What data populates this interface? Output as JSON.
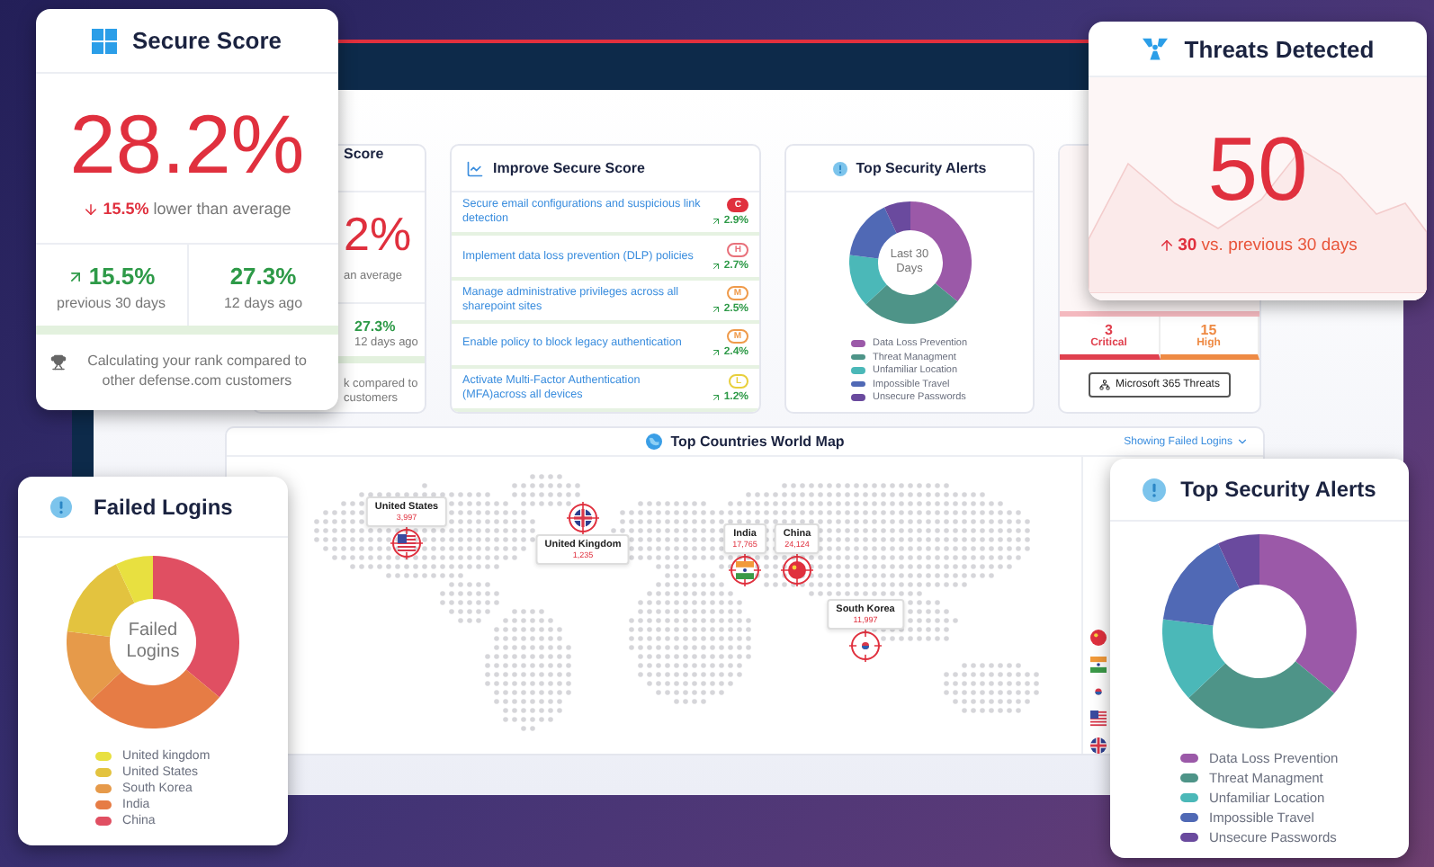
{
  "dashboard": {
    "secure_score_card": {
      "title": "Score",
      "value": "2%",
      "comparison": "an average",
      "stat_value": "27.3%",
      "stat_label": "12 days ago",
      "footer_lines": [
        "k compared to",
        "customers"
      ]
    },
    "improve_card": {
      "title": "Improve Secure Score",
      "items": [
        {
          "text": "Secure email configurations and suspicious link detection",
          "badge": "C",
          "color": "#e0303e",
          "change": "2.9%"
        },
        {
          "text": "Implement data loss prevention (DLP) policies",
          "badge": "H",
          "color": "#e8707a",
          "change": "2.7%"
        },
        {
          "text": "Manage administrative privileges across all sharepoint sites",
          "badge": "M",
          "color": "#ef9a4a",
          "change": "2.5%"
        },
        {
          "text": "Enable policy to block legacy authentication",
          "badge": "M",
          "color": "#ef9a4a",
          "change": "2.4%"
        },
        {
          "text": "Activate Multi-Factor Authentication (MFA)across all devices",
          "badge": "L",
          "color": "#e8cf3c",
          "change": "1.2%"
        }
      ]
    },
    "alerts_card": {
      "title": "Top Security Alerts",
      "center_label": "Last 30 Days",
      "legend": [
        {
          "label": "Data Loss Prevention",
          "color": "#9b59a8"
        },
        {
          "label": "Threat Managment",
          "color": "#4e9488"
        },
        {
          "label": "Unfamiliar Location",
          "color": "#4bb8b8"
        },
        {
          "label": "Impossible Travel",
          "color": "#5069b5"
        },
        {
          "label": "Unsecure Passwords",
          "color": "#6a4a9e"
        }
      ]
    },
    "threats_card": {
      "counts": [
        {
          "value": "3",
          "label": "Critical",
          "color": "#e0404e"
        },
        {
          "value": "15",
          "label": "High",
          "color": "#ee8a44"
        }
      ],
      "button": "Microsoft 365 Threats"
    },
    "map": {
      "title": "Top Countries World Map",
      "filter": "Showing Failed Logins",
      "markers": [
        {
          "country": "United States",
          "count": "3,997"
        },
        {
          "country": "United Kingdom",
          "count": "1,235"
        },
        {
          "country": "India",
          "count": "17,765"
        },
        {
          "country": "China",
          "count": "24,124"
        },
        {
          "country": "South Korea",
          "count": "11,997"
        }
      ]
    }
  },
  "overlays": {
    "secure_score": {
      "title": "Secure Score",
      "value": "28.2%",
      "comparison": "**15.5%** lower than average",
      "stats": [
        {
          "value": "15.5%",
          "label": "previous 30 days"
        },
        {
          "value": "27.3%",
          "label": "12 days ago"
        }
      ],
      "footer": "Calculating your rank compared to other defense.com customers"
    },
    "threats_detected": {
      "title": "Threats Detected",
      "value": "50",
      "comparison": "**30** vs. previous 30 days"
    },
    "failed_logins": {
      "title": "Failed Logins",
      "center_label": "Failed Logins",
      "legend": [
        {
          "label": "United kingdom",
          "color": "#e8e040"
        },
        {
          "label": "United States",
          "color": "#e3c33f"
        },
        {
          "label": "South Korea",
          "color": "#e69a4a"
        },
        {
          "label": "India",
          "color": "#e67c45"
        },
        {
          "label": "China",
          "color": "#e04f62"
        }
      ]
    },
    "top_security_alerts": {
      "title": "Top Security Alerts",
      "legend": [
        {
          "label": "Data Loss Prevention",
          "color": "#9b59a8"
        },
        {
          "label": "Threat Managment",
          "color": "#4e9488"
        },
        {
          "label": "Unfamiliar Location",
          "color": "#4bb8b8"
        },
        {
          "label": "Impossible Travel",
          "color": "#5069b5"
        },
        {
          "label": "Unsecure Passwords",
          "color": "#6a4a9e"
        }
      ]
    }
  }
}
